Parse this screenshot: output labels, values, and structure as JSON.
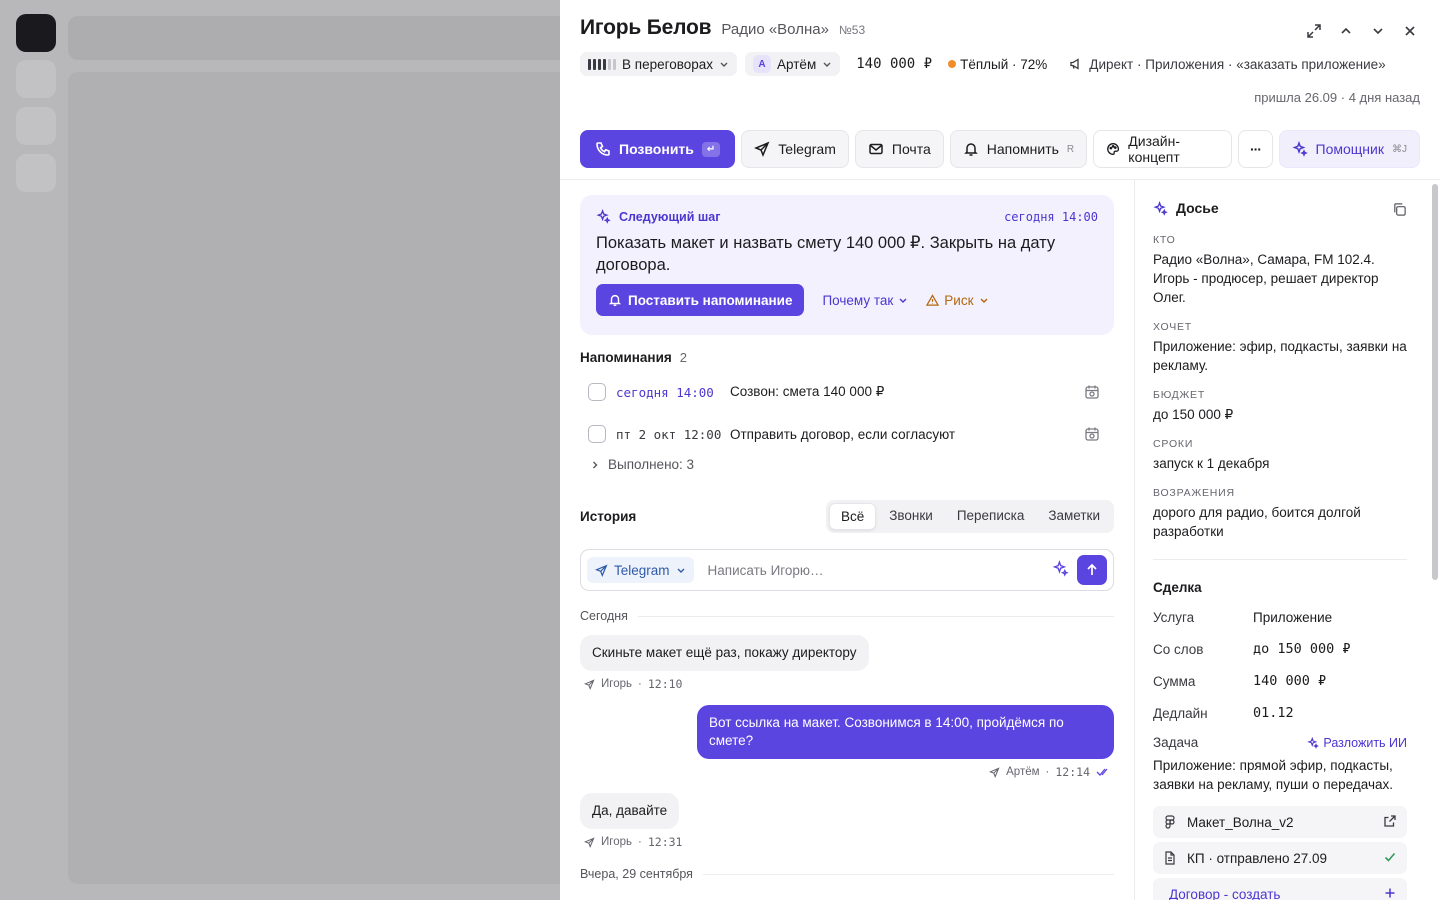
{
  "header": {
    "name": "Игорь Белов",
    "company": "Радио «Волна»",
    "number": "№53",
    "status": "В переговорах",
    "manager_initial": "А",
    "manager": "Артём",
    "amount": "140 000 ₽",
    "temperature": "Тёплый · 72%",
    "source": "Директ · Приложения · «заказать приложение»",
    "arrived": "пришла 26.09 · 4 дня назад"
  },
  "actions": {
    "call": "Позвонить",
    "call_kbd": "↵",
    "telegram": "Telegram",
    "mail": "Почта",
    "remind": "Напомнить",
    "remind_kbd": "R",
    "design": "Дизайн-концепт",
    "more": "···",
    "assistant": "Помощник",
    "assistant_kbd": "⌘J"
  },
  "next_step": {
    "label": "Следующий шаг",
    "when": "сегодня 14:00",
    "text": "Показать макет и назвать смету 140 000 ₽. Закрыть на дату договора.",
    "set_reminder": "Поставить напоминание",
    "why": "Почему так",
    "risk": "Риск"
  },
  "reminders": {
    "title": "Напоминания",
    "count": "2",
    "items": [
      {
        "time": "сегодня 14:00",
        "text": "Созвон: смета 140 000 ₽"
      },
      {
        "time": "пт 2 окт 12:00",
        "text": "Отправить договор, если согласуют"
      }
    ],
    "done": "Выполнено: 3"
  },
  "history": {
    "title": "История",
    "tabs": [
      "Всё",
      "Звонки",
      "Переписка",
      "Заметки"
    ],
    "channel": "Telegram",
    "placeholder": "Написать Игорю…",
    "today": "Сегодня",
    "yesterday": "Вчера, 29 сентября",
    "messages": [
      {
        "text": "Скиньте макет ещё раз, покажу директору",
        "author": "Игорь",
        "time": "12:10"
      },
      {
        "text": "Вот ссылка на макет. Созвонимся в 14:00, пройдёмся по смете?",
        "author": "Артём",
        "time": "12:14"
      },
      {
        "text": "Да, давайте",
        "author": "Игорь",
        "time": "12:31"
      }
    ]
  },
  "dossier": {
    "title": "Досье",
    "who_label": "КТО",
    "who": "Радио «Волна», Самара, FM 102.4. Игорь - продюсер, решает директор Олег.",
    "wants_label": "ХОЧЕТ",
    "wants": "Приложение: эфир, подкасты, заявки на рекламу.",
    "budget_label": "БЮДЖЕТ",
    "budget": "до 150 000 ₽",
    "terms_label": "СРОКИ",
    "terms": "запуск к 1 декабря",
    "objections_label": "ВОЗРАЖЕНИЯ",
    "objections": "дорого для радио, боится долгой разработки"
  },
  "deal": {
    "title": "Сделка",
    "service_k": "Услуга",
    "service_v": "Приложение",
    "words_k": "Со слов",
    "words_v": "до 150 000 ₽",
    "sum_k": "Сумма",
    "sum_v": "140 000 ₽",
    "deadline_k": "Дедлайн",
    "deadline_v": "01.12",
    "task_k": "Задача",
    "task_ai": "Разложить ИИ",
    "task": "Приложение: прямой эфир, подкасты, заявки на рекламу, пуши о передачах.",
    "file1": "Макет_Волна_v2",
    "file2": "КП · отправлено 27.09",
    "file3": "Договор - создать"
  },
  "colors": {
    "accent": "#5b45e0",
    "warm": "#f08c2a"
  }
}
